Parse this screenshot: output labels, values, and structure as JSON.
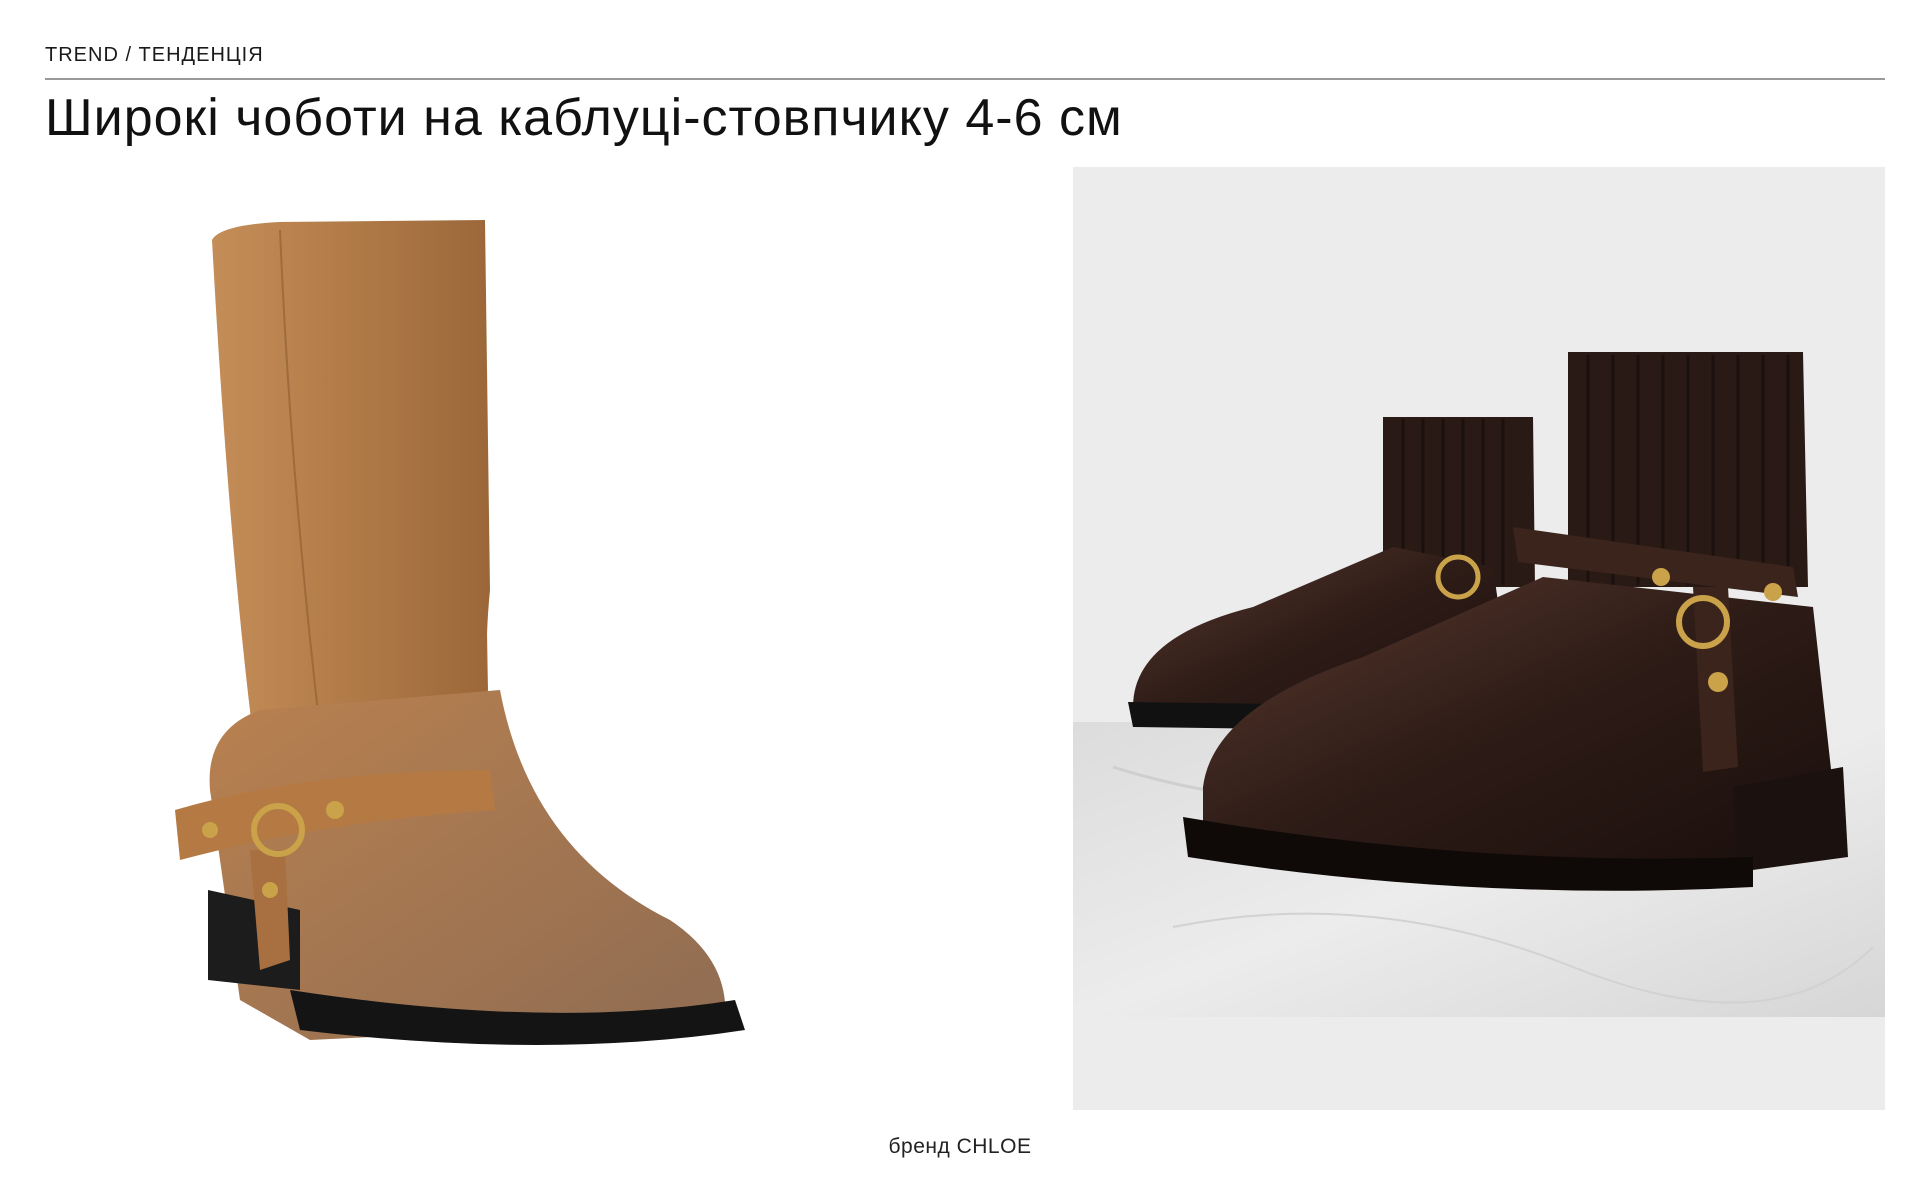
{
  "header": {
    "eyebrow": "TREND / ТЕНДЕНЦІЯ",
    "title": "Широкі чоботи на каблуці-стовпчику 4-6 см"
  },
  "footer": {
    "caption": "бренд CHLOE"
  },
  "colors": {
    "suede_tan": "#b07a47",
    "dark_leather": "#2d1b16",
    "brass": "#c9a24a",
    "marble": "#e4e4e4",
    "backdrop": "#ececec"
  }
}
